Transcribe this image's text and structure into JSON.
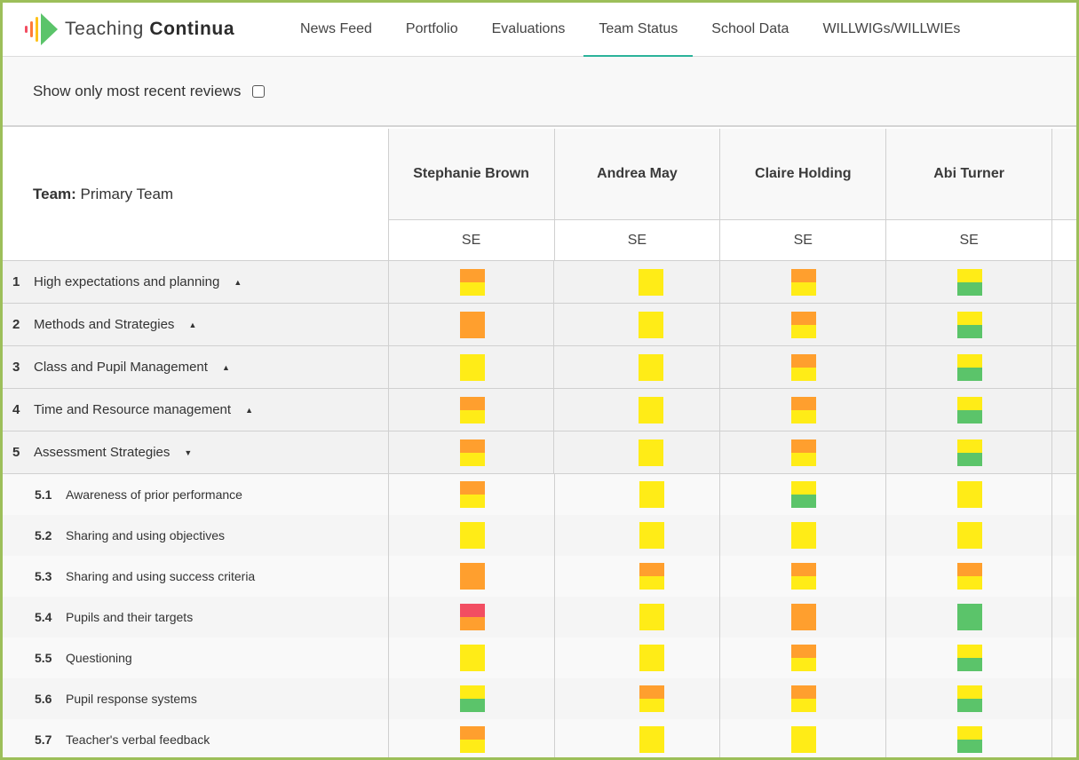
{
  "app": {
    "logo_text_light": "Teaching",
    "logo_text_bold": "Continua",
    "logo_icon": "play-sound-wave-icon"
  },
  "nav": {
    "items": [
      {
        "label": "News Feed",
        "active": false
      },
      {
        "label": "Portfolio",
        "active": false
      },
      {
        "label": "Evaluations",
        "active": false
      },
      {
        "label": "Team Status",
        "active": true
      },
      {
        "label": "School Data",
        "active": false
      },
      {
        "label": "WILLWIGs/WILLWIEs",
        "active": false
      }
    ],
    "active_color": "#2bb39a"
  },
  "filter": {
    "label": "Show only most recent reviews",
    "checked": false
  },
  "team": {
    "label": "Team:",
    "value": "Primary Team"
  },
  "colors": {
    "red": "#f24e62",
    "orange": "#ff9f2e",
    "yellow": "#ffec17",
    "green": "#5bc46a"
  },
  "people": [
    {
      "name": "Stephanie Brown",
      "role": "SE"
    },
    {
      "name": "Andrea May",
      "role": "SE"
    },
    {
      "name": "Claire Holding",
      "role": "SE"
    },
    {
      "name": "Abi Turner",
      "role": "SE"
    }
  ],
  "rows": [
    {
      "type": "cat",
      "num": "1",
      "name": "High expectations and planning",
      "arrow": "▲",
      "scores": [
        [
          "orange",
          "yellow"
        ],
        [
          "yellow"
        ],
        [
          "orange",
          "yellow"
        ],
        [
          "yellow",
          "green"
        ]
      ]
    },
    {
      "type": "cat",
      "num": "2",
      "name": "Methods and Strategies",
      "arrow": "▲",
      "scores": [
        [
          "orange"
        ],
        [
          "yellow"
        ],
        [
          "orange",
          "yellow"
        ],
        [
          "yellow",
          "green"
        ]
      ]
    },
    {
      "type": "cat",
      "num": "3",
      "name": "Class and Pupil Management",
      "arrow": "▲",
      "scores": [
        [
          "yellow"
        ],
        [
          "yellow"
        ],
        [
          "orange",
          "yellow"
        ],
        [
          "yellow",
          "green"
        ]
      ]
    },
    {
      "type": "cat",
      "num": "4",
      "name": "Time and Resource management",
      "arrow": "▲",
      "scores": [
        [
          "orange",
          "yellow"
        ],
        [
          "yellow"
        ],
        [
          "orange",
          "yellow"
        ],
        [
          "yellow",
          "green"
        ]
      ]
    },
    {
      "type": "cat",
      "num": "5",
      "name": "Assessment Strategies",
      "arrow": "▼",
      "scores": [
        [
          "orange",
          "yellow"
        ],
        [
          "yellow"
        ],
        [
          "orange",
          "yellow"
        ],
        [
          "yellow",
          "green"
        ]
      ]
    },
    {
      "type": "sub",
      "num": "5.1",
      "name": "Awareness of prior performance",
      "scores": [
        [
          "orange",
          "yellow"
        ],
        [
          "yellow"
        ],
        [
          "yellow",
          "green"
        ],
        [
          "yellow"
        ]
      ]
    },
    {
      "type": "sub",
      "num": "5.2",
      "name": "Sharing and using objectives",
      "scores": [
        [
          "yellow"
        ],
        [
          "yellow"
        ],
        [
          "yellow"
        ],
        [
          "yellow"
        ]
      ]
    },
    {
      "type": "sub",
      "num": "5.3",
      "name": "Sharing and using success criteria",
      "scores": [
        [
          "orange"
        ],
        [
          "orange",
          "yellow"
        ],
        [
          "orange",
          "yellow"
        ],
        [
          "orange",
          "yellow"
        ]
      ]
    },
    {
      "type": "sub",
      "num": "5.4",
      "name": "Pupils and their targets",
      "scores": [
        [
          "red",
          "orange"
        ],
        [
          "yellow"
        ],
        [
          "orange"
        ],
        [
          "green"
        ]
      ]
    },
    {
      "type": "sub",
      "num": "5.5",
      "name": "Questioning",
      "scores": [
        [
          "yellow"
        ],
        [
          "yellow"
        ],
        [
          "orange",
          "yellow"
        ],
        [
          "yellow",
          "green"
        ]
      ]
    },
    {
      "type": "sub",
      "num": "5.6",
      "name": "Pupil response systems",
      "scores": [
        [
          "yellow",
          "green"
        ],
        [
          "orange",
          "yellow"
        ],
        [
          "orange",
          "yellow"
        ],
        [
          "yellow",
          "green"
        ]
      ]
    },
    {
      "type": "sub",
      "num": "5.7",
      "name": "Teacher's verbal feedback",
      "scores": [
        [
          "orange",
          "yellow"
        ],
        [
          "yellow"
        ],
        [
          "yellow"
        ],
        [
          "yellow",
          "green"
        ]
      ]
    }
  ]
}
